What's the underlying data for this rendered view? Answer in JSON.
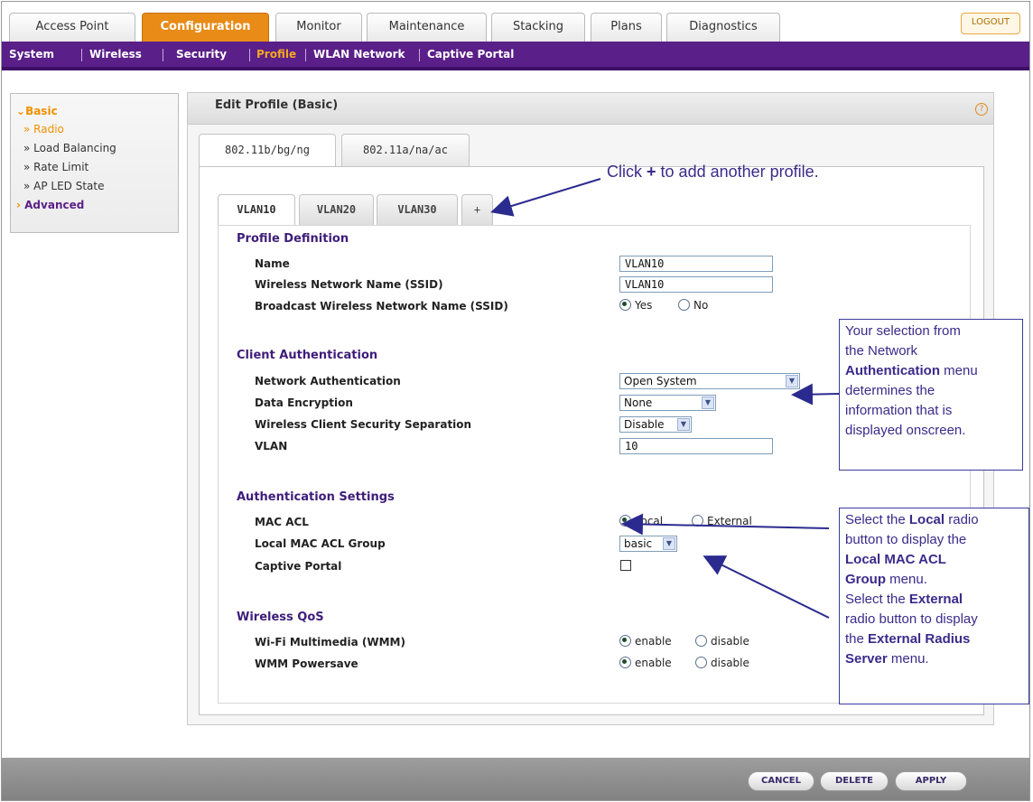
{
  "top_tabs": [
    "Access Point",
    "Configuration",
    "Monitor",
    "Maintenance",
    "Stacking",
    "Plans",
    "Diagnostics"
  ],
  "logout_label": "LOGOUT",
  "subnav": [
    "System",
    "Wireless",
    "Security",
    "Profile",
    "WLAN Network",
    "Captive Portal"
  ],
  "sidebar": {
    "basic": "Basic",
    "items": [
      "» Radio",
      "» Load Balancing",
      "» Rate Limit",
      "» AP LED State"
    ],
    "advanced": "Advanced",
    "basic_marker": "⌄",
    "advanced_marker": "›"
  },
  "panel": {
    "title": "Edit Profile (Basic)",
    "help": "?",
    "band_tabs": [
      "802.11b/bg/ng",
      "802.11a/na/ac"
    ],
    "vlan_tabs": [
      "VLAN10",
      "VLAN20",
      "VLAN30",
      "+"
    ]
  },
  "profile_definition": {
    "heading": "Profile Definition",
    "name_label": "Name",
    "name_value": "VLAN10",
    "ssid_label": "Wireless Network Name (SSID)",
    "ssid_value": "VLAN10",
    "broadcast_label": "Broadcast Wireless Network Name (SSID)",
    "yes": "Yes",
    "no": "No"
  },
  "client_authentication": {
    "heading": "Client Authentication",
    "network_auth_label": "Network Authentication",
    "network_auth_value": "Open System",
    "data_encryption_label": "Data Encryption",
    "data_encryption_value": "None",
    "separation_label": "Wireless Client Security Separation",
    "separation_value": "Disable",
    "vlan_label": "VLAN",
    "vlan_value": "10"
  },
  "authentication_settings": {
    "heading": "Authentication Settings",
    "mac_acl_label": "MAC ACL",
    "local": "Local",
    "external": "External",
    "local_group_label": "Local MAC ACL Group",
    "local_group_value": "basic",
    "captive_portal_label": "Captive Portal"
  },
  "wireless_qos": {
    "heading": "Wireless QoS",
    "wmm_label": "Wi-Fi Multimedia (WMM)",
    "powersave_label": "WMM Powersave",
    "enable": "enable",
    "disable": "disable"
  },
  "footer": {
    "cancel": "CANCEL",
    "delete": "DELETE",
    "apply": "APPLY"
  },
  "annotations": {
    "plus_note_pre": "Click",
    "plus_note_plus": "+",
    "plus_note_post": "to add another profile.",
    "auth_note": [
      "Your selection from",
      "the Network",
      "Authentication",
      "menu",
      "determines the",
      "information that is",
      "displayed onscreen."
    ],
    "acl_note": [
      "Select the",
      "Local",
      "radio",
      "button to display the",
      "Local MAC ACL",
      "Group",
      "menu.",
      "Select the",
      "External",
      "radio button to display",
      "the",
      "External Radius",
      "Server",
      "menu."
    ]
  },
  "colors": {
    "accent_orange": "#e88b17",
    "nav_purple": "#5a1f88",
    "callout_text": "#3b2a8a"
  }
}
